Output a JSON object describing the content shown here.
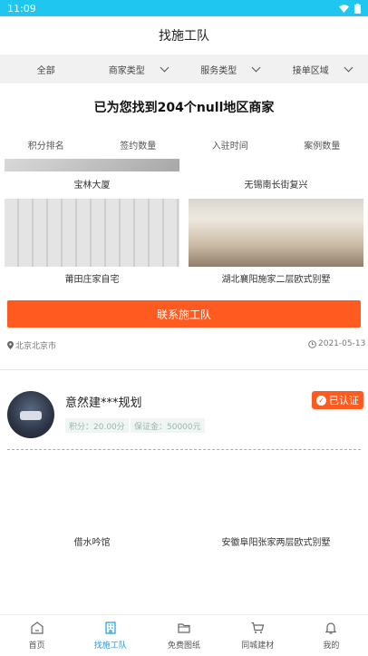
{
  "status": {
    "time": "11:09"
  },
  "header": {
    "title": "找施工队"
  },
  "filters": [
    {
      "label": "全部"
    },
    {
      "label": "商家类型"
    },
    {
      "label": "服务类型"
    },
    {
      "label": "接单区域"
    }
  ],
  "result": {
    "text": "已为您找到204个null地区商家"
  },
  "sort": [
    "积分排名",
    "签约数量",
    "入驻时间",
    "案例数量"
  ],
  "card1": {
    "cases": [
      "宝林大厦",
      "无锡南长街复兴",
      "莆田庄家自宅",
      "湖北襄阳施家二层欧式别墅"
    ],
    "contact_label": "联系施工队",
    "location": "北京北京市",
    "date": "2021-05-13"
  },
  "card2": {
    "company": "意然建***规划",
    "badge": "已认证",
    "points": "积分：20.00分",
    "deposit": "保证金：50000元",
    "cases": [
      "借水吟馆",
      "安徽阜阳张家两层欧式别墅"
    ]
  },
  "tabbar": {
    "items": [
      {
        "label": "首页",
        "icon": "home-icon"
      },
      {
        "label": "找施工队",
        "icon": "building-icon"
      },
      {
        "label": "免费图纸",
        "icon": "folder-icon"
      },
      {
        "label": "同城建材",
        "icon": "cart-icon"
      },
      {
        "label": "我的",
        "icon": "bell-icon"
      }
    ],
    "active_color": "#1f9bdc"
  },
  "colors": {
    "accent": "#ff5a1f",
    "status_bar": "#1ec6f0"
  }
}
